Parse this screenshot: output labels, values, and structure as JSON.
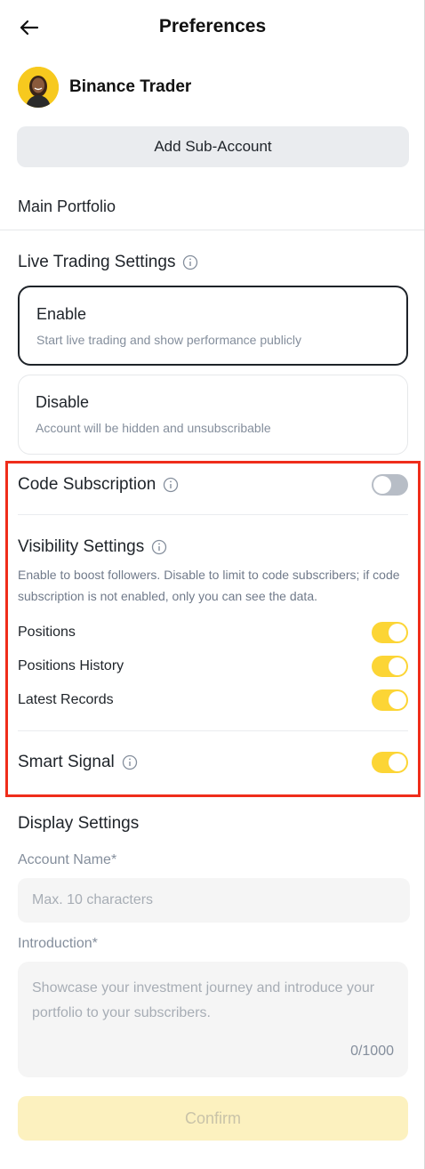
{
  "header": {
    "title": "Preferences",
    "back_icon": "arrow-left-icon"
  },
  "profile": {
    "name": "Binance Trader",
    "avatar_bg": "#F7C91E"
  },
  "add_sub_account": {
    "label": "Add Sub-Account"
  },
  "portfolio": {
    "label": "Main Portfolio"
  },
  "live_trading": {
    "title": "Live Trading Settings",
    "options": [
      {
        "title": "Enable",
        "desc": "Start live trading and show performance publicly",
        "selected": true
      },
      {
        "title": "Disable",
        "desc": "Account will be hidden and unsubscribable",
        "selected": false
      }
    ]
  },
  "code_subscription": {
    "title": "Code Subscription",
    "enabled": false
  },
  "visibility": {
    "title": "Visibility Settings",
    "desc": "Enable to boost followers. Disable to limit to code subscribers; if code subscription is not enabled, only you can see the data.",
    "items": [
      {
        "label": "Positions",
        "enabled": true
      },
      {
        "label": "Positions History",
        "enabled": true
      },
      {
        "label": "Latest Records",
        "enabled": true
      }
    ]
  },
  "smart_signal": {
    "title": "Smart Signal",
    "enabled": true
  },
  "display_settings": {
    "title": "Display Settings",
    "account_name_label": "Account Name*",
    "account_name_placeholder": "Max. 10 characters",
    "account_name_value": "",
    "intro_label": "Introduction*",
    "intro_placeholder": "Showcase your investment journey and introduce your portfolio to your subscribers.",
    "intro_value": "",
    "intro_counter": "0/1000"
  },
  "confirm": {
    "label": "Confirm",
    "enabled": false
  },
  "colors": {
    "accent": "#FCD535",
    "highlight_border": "#EF2D1B",
    "text": "#1E2329",
    "muted": "#848E9C"
  }
}
